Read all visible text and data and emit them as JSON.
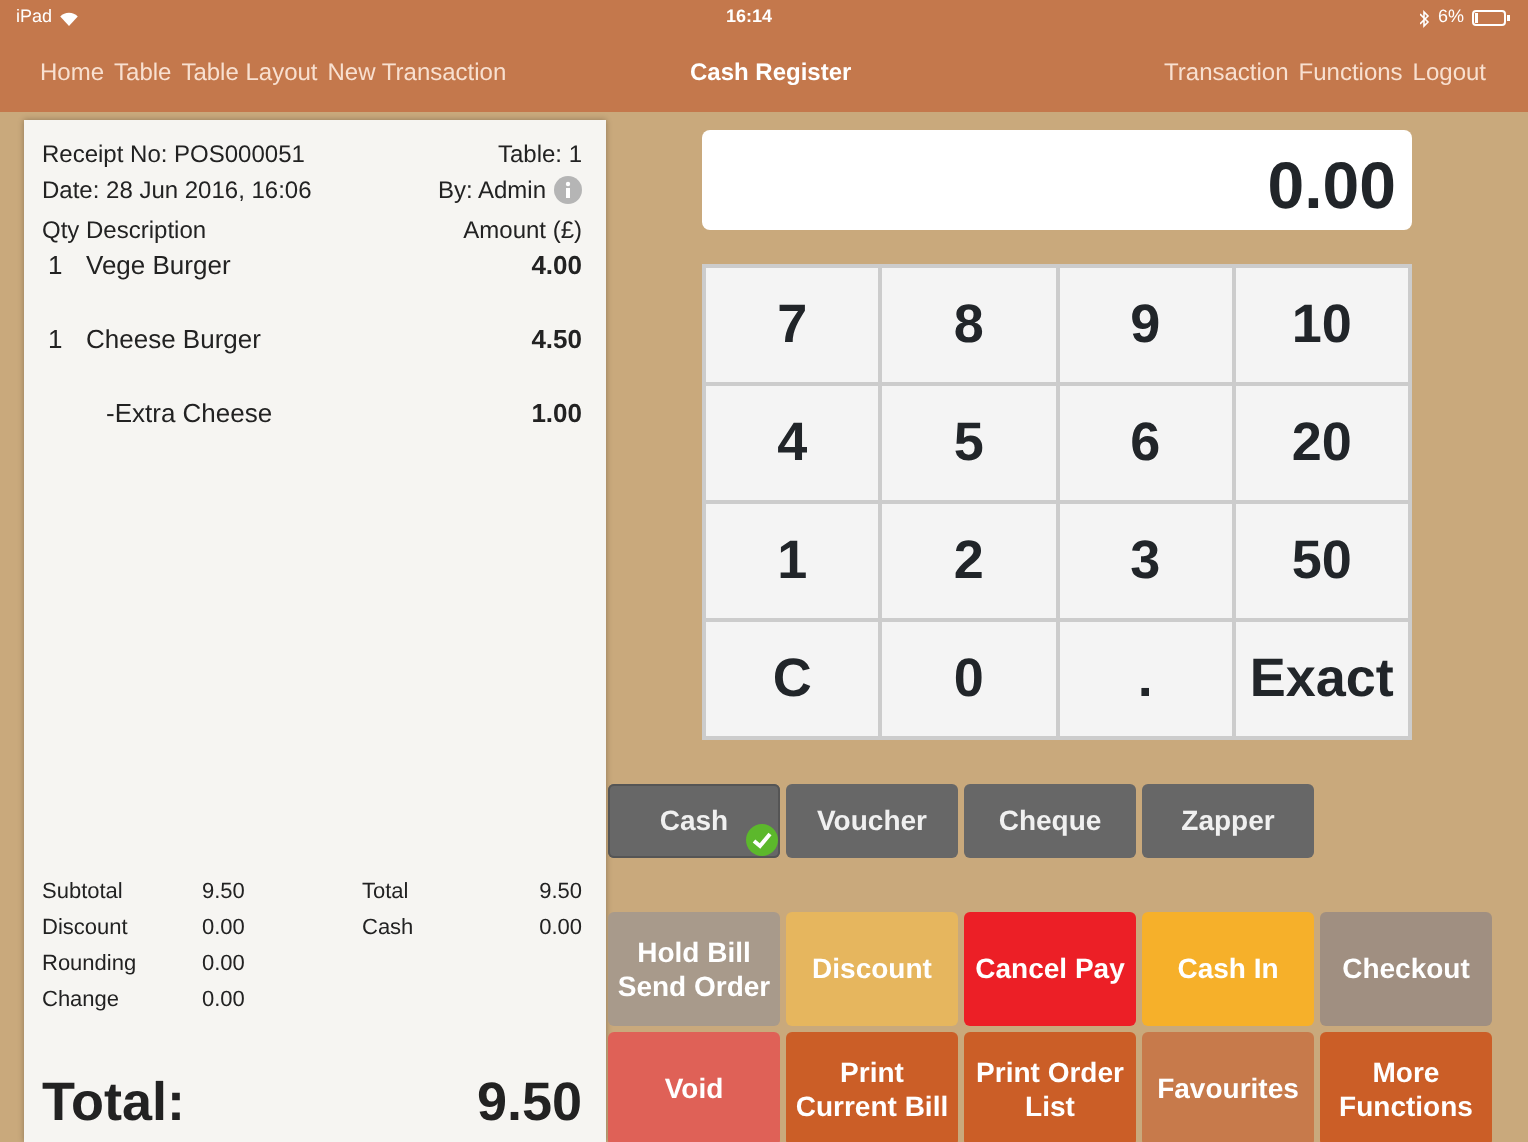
{
  "status_bar": {
    "device": "iPad",
    "time": "16:14",
    "battery": "6%"
  },
  "nav": {
    "left_links": [
      "Home",
      "Table",
      "Table Layout",
      "New Transaction"
    ],
    "title": "Cash Register",
    "right_links": [
      "Transaction",
      "Functions",
      "Logout"
    ]
  },
  "receipt": {
    "receipt_no": "Receipt No: POS000051",
    "table": "Table: 1",
    "date": "Date: 28 Jun 2016, 16:06",
    "by": "By: Admin",
    "columns": [
      "Qty",
      "Description",
      "Amount (£)"
    ],
    "items": [
      {
        "qty": "1",
        "description": "Vege Burger",
        "amount": "4.00",
        "kind": "item"
      },
      {
        "qty": "1",
        "description": "Cheese Burger",
        "amount": "4.50",
        "kind": "item"
      },
      {
        "description": "-Extra Cheese",
        "amount": "1.00",
        "kind": "modifier"
      }
    ],
    "summary_left": [
      {
        "label": "Subtotal",
        "value": "9.50"
      },
      {
        "label": "Discount",
        "value": "0.00"
      },
      {
        "label": "Rounding",
        "value": "0.00"
      },
      {
        "label": "Change",
        "value": "0.00"
      }
    ],
    "summary_right": [
      {
        "label": "Total",
        "value": "9.50"
      },
      {
        "label": "Cash",
        "value": "0.00"
      }
    ],
    "total_label": "Total:",
    "total_value": "9.50"
  },
  "display": {
    "value": "0.00"
  },
  "keypad": [
    "7",
    "8",
    "9",
    "10",
    "4",
    "5",
    "6",
    "20",
    "1",
    "2",
    "3",
    "50",
    "C",
    "0",
    ".",
    "Exact"
  ],
  "payment_methods": [
    {
      "label": "Cash",
      "selected": true
    },
    {
      "label": "Voucher",
      "selected": false
    },
    {
      "label": "Cheque",
      "selected": false
    },
    {
      "label": "Zapper",
      "selected": false
    }
  ],
  "actions": [
    {
      "label": "Hold Bill\nSend Order",
      "color": "#a89a8b"
    },
    {
      "label": "Discount",
      "color": "#e6b65e"
    },
    {
      "label": "Cancel Pay",
      "color": "#ec1f26"
    },
    {
      "label": "Cash In",
      "color": "#f6b02a"
    },
    {
      "label": "Checkout",
      "color": "#a08f81"
    },
    {
      "label": "Void",
      "color": "#df6157"
    },
    {
      "label": "Print\nCurrent Bill",
      "color": "#cb5e27"
    },
    {
      "label": "Print Order\nList",
      "color": "#cb5e27"
    },
    {
      "label": "Favourites",
      "color": "#c77a4b"
    },
    {
      "label": "More\nFunctions",
      "color": "#cb5e27"
    }
  ]
}
